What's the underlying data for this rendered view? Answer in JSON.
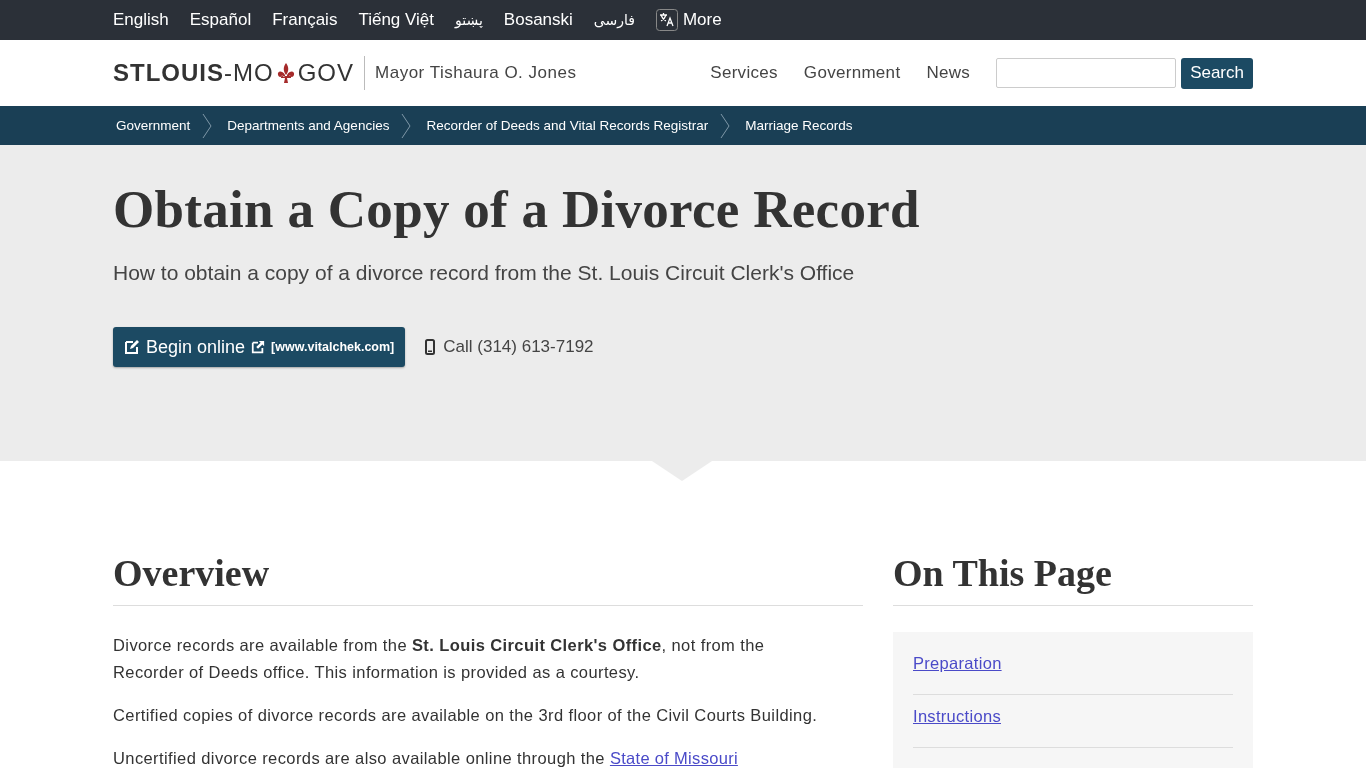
{
  "languages": [
    {
      "label": "English",
      "kind": "text"
    },
    {
      "label": "Español",
      "kind": "text"
    },
    {
      "label": "Français",
      "kind": "text"
    },
    {
      "label": "Tiếng Việt",
      "kind": "text"
    },
    {
      "label": "پښتو",
      "kind": "rtl"
    },
    {
      "label": "Bosanski",
      "kind": "text"
    },
    {
      "label": "فارسی",
      "kind": "rtl"
    },
    {
      "label": "More",
      "kind": "more"
    }
  ],
  "header": {
    "logo_bold": "STLOUIS",
    "logo_mid": "-MO",
    "logo_end": "GOV",
    "mayor": "Mayor Tishaura O. Jones",
    "nav": [
      "Services",
      "Government",
      "News"
    ],
    "search_button": "Search"
  },
  "breadcrumbs": [
    "Government",
    "Departments and Agencies",
    "Recorder of Deeds and Vital Records Registrar",
    "Marriage Records"
  ],
  "hero": {
    "title": "Obtain a Copy of a Divorce Record",
    "subtitle": "How to obtain a copy of a divorce record from the St. Louis Circuit Clerk's Office",
    "button": "Begin online",
    "button_url": "[www.vitalchek.com]",
    "phone": "Call (314) 613-7192"
  },
  "overview": {
    "heading": "Overview",
    "paragraphs": [
      {
        "text": "Divorce records are available from the **St. Louis Circuit Clerk's Office**, not from the Recorder of Deeds office. This information is provided as a courtesy."
      },
      {
        "text": "Certified copies of divorce records are available on the 3rd floor of the Civil Courts Building."
      },
      {
        "text": "Uncertified divorce records are also available online through the",
        "link": "State of Missouri"
      }
    ]
  },
  "on_this_page": {
    "heading": "On This Page",
    "links": [
      "Preparation",
      "Instructions"
    ]
  }
}
